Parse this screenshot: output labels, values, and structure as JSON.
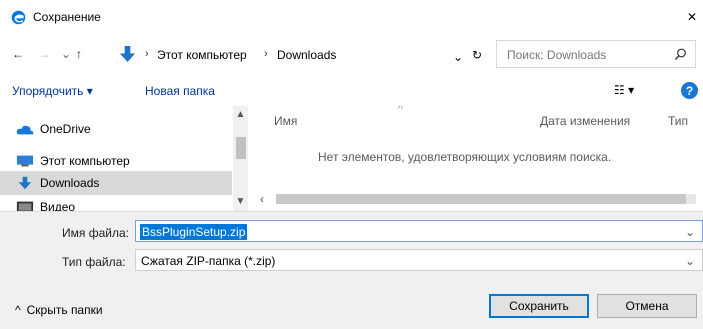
{
  "window": {
    "title": "Сохранение",
    "close_label": "✕"
  },
  "navigation": {
    "back_label": "←",
    "forward_label": "→",
    "recent_label": "⌄",
    "up_label": "↑",
    "crumb_separator": "›",
    "crumbs": [
      "Этот компьютер",
      "Downloads"
    ],
    "dropdown_label": "⌄",
    "refresh_label": "↻",
    "search_placeholder": "Поиск: Downloads"
  },
  "toolbar": {
    "organize_label": "Упорядочить ▾",
    "new_folder_label": "Новая папка",
    "view_label": "☷ ▾",
    "help_label": "?"
  },
  "sidebar": {
    "items": [
      {
        "label": "OneDrive",
        "icon": "cloud-icon"
      },
      {
        "label": "Этот компьютер",
        "icon": "computer-icon"
      },
      {
        "label": "Downloads",
        "icon": "download-folder-icon",
        "selected": true
      },
      {
        "label": "Видео",
        "icon": "video-folder-icon"
      }
    ],
    "scroll_up": "▲",
    "scroll_down": "▼"
  },
  "files": {
    "columns": [
      "Имя",
      "Дата изменения",
      "Тип"
    ],
    "sort_indicator": "^",
    "empty_message": "Нет элементов, удовлетворяющих условиям поиска.",
    "hscroll_left": "‹"
  },
  "save_form": {
    "filename_label": "Имя файла:",
    "filename_value": "BssPluginSetup.zip",
    "filetype_label": "Тип файла:",
    "filetype_value": "Сжатая ZIP-папка (*.zip)",
    "dropdown_arrow": "⌄",
    "hide_folders_label": "Скрыть папки",
    "hide_folders_arrow": "^",
    "save_label": "Сохранить",
    "cancel_label": "Отмена"
  },
  "colors": {
    "accent": "#0078d7",
    "link": "#003399",
    "help": "#1976d2",
    "selection": "#d9d9d9"
  }
}
